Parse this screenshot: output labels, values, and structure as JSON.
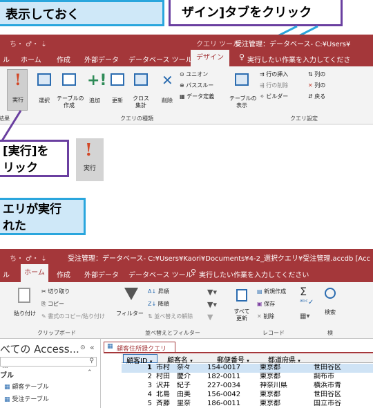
{
  "callouts": {
    "top_left": "表示しておく",
    "top_right": "ザイン]タブをクリック",
    "run": "[実行]を\nリック",
    "result": "エリが実行\nれた"
  },
  "top_window": {
    "quick_access": "ち・ ♂・ ⇣",
    "tool_label": "クエリ ツール",
    "title": "受注管理：データベース- C:¥Users¥",
    "tabs": [
      "ル",
      "ホーム",
      "作成",
      "外部データ",
      "データベース ツール",
      "デザイン"
    ],
    "tell_me": "実行したい作業を入力してくださ",
    "ribbon": {
      "run_label": "実行",
      "select_label": "選択",
      "make_table_label": "テーブルの\n作成",
      "append_label": "追加",
      "update_label": "更新",
      "crosstab_label": "クロス\n集計",
      "delete_label": "削除",
      "union_label": "ユニオン",
      "pass_label": "パススルー",
      "data_def_label": "データ定義",
      "show_table_label": "テーブルの\n表示",
      "insert_row_label": "行の挿入",
      "delete_row_label": "行の削除",
      "builder_label": "ビルダー",
      "insert_col_label": "列の",
      "delete_col_label": "列の",
      "return_label": "戻る",
      "group_query_type": "クエリの種類",
      "group_query_setup": "クエリ設定",
      "group_result": "結果"
    }
  },
  "run_icon_label": "実行",
  "bottom_window": {
    "title": "受注管理：データベース- C:¥Users¥Kaori¥Documents¥4-2_選択クエリ¥受注管理.accdb [Acc",
    "tabs": [
      "ル",
      "ホーム",
      "作成",
      "外部データ",
      "データベース ツール"
    ],
    "tell_me": "実行したい作業を入力してください",
    "ribbon": {
      "cut": "切り取り",
      "copy": "コピー",
      "paste": "貼り付け",
      "format_painter": "書式のコピー/貼り付け",
      "clipboard": "クリップボード",
      "filter": "フィルター",
      "asc": "昇順",
      "desc": "降順",
      "clear_sort": "並べ替えの解除",
      "sort_filter": "並べ替えとフィルター",
      "new": "新規作成",
      "save": "保存",
      "refresh_all": "すべて\n更新",
      "delete": "削除",
      "records": "レコード",
      "find": "検索",
      "find_group": "検"
    },
    "nav_title": "べての Access...",
    "nav_search": "...",
    "nav_section": "ブル",
    "nav_items": [
      "顧客テーブル",
      "受注テーブル"
    ],
    "query_tab": "顧客住所録クエリ",
    "columns": [
      "顧客ID",
      "顧客名",
      "郵便番号",
      "都道府県"
    ],
    "rows": [
      [
        "1",
        "市村　奈々",
        "154-0017",
        "東京都",
        "世田谷区"
      ],
      [
        "2",
        "村田　慶介",
        "182-0011",
        "東京都",
        "調布市"
      ],
      [
        "3",
        "沢井　紀子",
        "227-0034",
        "神奈川県",
        "横浜市青"
      ],
      [
        "4",
        "北島　由美",
        "156-0042",
        "東京都",
        "世田谷区"
      ],
      [
        "5",
        "斉藤　里奈",
        "186-0011",
        "東京都",
        "国立市谷"
      ]
    ]
  }
}
